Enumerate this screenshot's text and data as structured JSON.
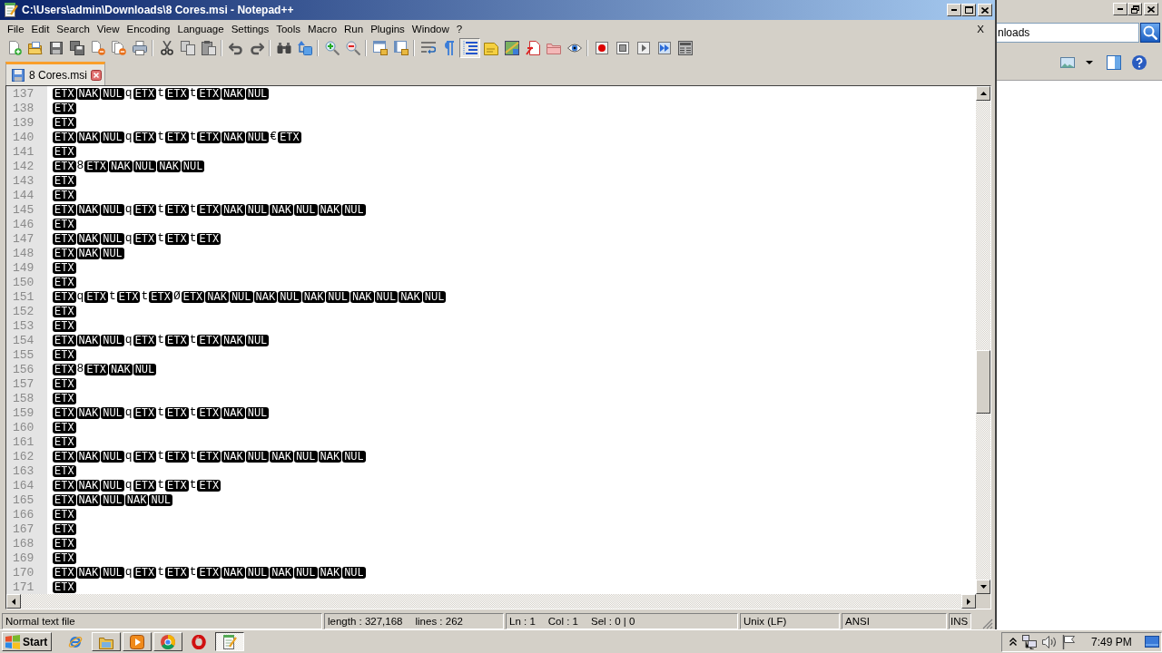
{
  "window": {
    "title": "C:\\Users\\admin\\Downloads\\8 Cores.msi - Notepad++"
  },
  "menu": {
    "items": [
      "File",
      "Edit",
      "Search",
      "View",
      "Encoding",
      "Language",
      "Settings",
      "Tools",
      "Macro",
      "Run",
      "Plugins",
      "Window",
      "?"
    ],
    "close": "X"
  },
  "toolbar": {
    "groups": [
      [
        {
          "kind": "new",
          "pressed": false
        },
        {
          "kind": "open",
          "pressed": false
        },
        {
          "kind": "save",
          "pressed": false
        },
        {
          "kind": "saveall",
          "pressed": false
        },
        {
          "kind": "close",
          "pressed": false
        },
        {
          "kind": "closeall",
          "pressed": false
        },
        {
          "kind": "print",
          "pressed": false
        }
      ],
      [
        {
          "kind": "cut",
          "pressed": false
        },
        {
          "kind": "copy",
          "pressed": false
        },
        {
          "kind": "paste",
          "pressed": false
        }
      ],
      [
        {
          "kind": "undo",
          "pressed": false
        },
        {
          "kind": "redo",
          "pressed": false
        }
      ],
      [
        {
          "kind": "find",
          "pressed": false
        },
        {
          "kind": "replace",
          "pressed": false
        }
      ],
      [
        {
          "kind": "zoomin",
          "pressed": false
        },
        {
          "kind": "zoomout",
          "pressed": false
        }
      ],
      [
        {
          "kind": "syncv",
          "pressed": false
        },
        {
          "kind": "synch",
          "pressed": false
        }
      ],
      [
        {
          "kind": "wrap",
          "pressed": false
        },
        {
          "kind": "allchars",
          "pressed": false
        },
        {
          "kind": "indent",
          "pressed": true
        },
        {
          "kind": "udl",
          "pressed": false
        },
        {
          "kind": "docmap",
          "pressed": false
        },
        {
          "kind": "funclist",
          "pressed": false
        },
        {
          "kind": "folder",
          "pressed": false
        },
        {
          "kind": "monitor",
          "pressed": false
        }
      ],
      [
        {
          "kind": "record",
          "pressed": false
        },
        {
          "kind": "stop",
          "pressed": false
        },
        {
          "kind": "play",
          "pressed": false
        },
        {
          "kind": "playmulti",
          "pressed": false
        },
        {
          "kind": "savemacro",
          "pressed": false
        }
      ]
    ]
  },
  "tabs": [
    {
      "label": "8 Cores.msi",
      "selected": true
    }
  ],
  "editor": {
    "lines": [
      {
        "number": "137",
        "tokens": [
          {
            "kind": "ctrl",
            "text": "ETX"
          },
          {
            "kind": "ctrl",
            "text": "NAK"
          },
          {
            "kind": "ctrl",
            "text": "NUL"
          },
          {
            "kind": "char",
            "text": "q"
          },
          {
            "kind": "ctrl",
            "text": "ETX"
          },
          {
            "kind": "char",
            "text": "t"
          },
          {
            "kind": "ctrl",
            "text": "ETX"
          },
          {
            "kind": "char",
            "text": "t"
          },
          {
            "kind": "ctrl",
            "text": "ETX"
          },
          {
            "kind": "ctrl",
            "text": "NAK"
          },
          {
            "kind": "ctrl",
            "text": "NUL"
          }
        ]
      },
      {
        "number": "138",
        "tokens": [
          {
            "kind": "ctrl",
            "text": "ETX"
          }
        ]
      },
      {
        "number": "139",
        "tokens": [
          {
            "kind": "ctrl",
            "text": "ETX"
          }
        ]
      },
      {
        "number": "140",
        "tokens": [
          {
            "kind": "ctrl",
            "text": "ETX"
          },
          {
            "kind": "ctrl",
            "text": "NAK"
          },
          {
            "kind": "ctrl",
            "text": "NUL"
          },
          {
            "kind": "char",
            "text": "q"
          },
          {
            "kind": "ctrl",
            "text": "ETX"
          },
          {
            "kind": "char",
            "text": "t"
          },
          {
            "kind": "ctrl",
            "text": "ETX"
          },
          {
            "kind": "char",
            "text": "t"
          },
          {
            "kind": "ctrl",
            "text": "ETX"
          },
          {
            "kind": "ctrl",
            "text": "NAK"
          },
          {
            "kind": "ctrl",
            "text": "NUL"
          },
          {
            "kind": "char",
            "text": "€"
          },
          {
            "kind": "ctrl",
            "text": "ETX"
          }
        ]
      },
      {
        "number": "141",
        "tokens": [
          {
            "kind": "ctrl",
            "text": "ETX"
          }
        ]
      },
      {
        "number": "142",
        "tokens": [
          {
            "kind": "ctrl",
            "text": "ETX"
          },
          {
            "kind": "char",
            "text": "8"
          },
          {
            "kind": "ctrl",
            "text": "ETX"
          },
          {
            "kind": "ctrl",
            "text": "NAK"
          },
          {
            "kind": "ctrl",
            "text": "NUL"
          },
          {
            "kind": "ctrl",
            "text": "NAK"
          },
          {
            "kind": "ctrl",
            "text": "NUL"
          }
        ]
      },
      {
        "number": "143",
        "tokens": [
          {
            "kind": "ctrl",
            "text": "ETX"
          }
        ]
      },
      {
        "number": "144",
        "tokens": [
          {
            "kind": "ctrl",
            "text": "ETX"
          }
        ]
      },
      {
        "number": "145",
        "tokens": [
          {
            "kind": "ctrl",
            "text": "ETX"
          },
          {
            "kind": "ctrl",
            "text": "NAK"
          },
          {
            "kind": "ctrl",
            "text": "NUL"
          },
          {
            "kind": "char",
            "text": "q"
          },
          {
            "kind": "ctrl",
            "text": "ETX"
          },
          {
            "kind": "char",
            "text": "t"
          },
          {
            "kind": "ctrl",
            "text": "ETX"
          },
          {
            "kind": "char",
            "text": "t"
          },
          {
            "kind": "ctrl",
            "text": "ETX"
          },
          {
            "kind": "ctrl",
            "text": "NAK"
          },
          {
            "kind": "ctrl",
            "text": "NUL"
          },
          {
            "kind": "ctrl",
            "text": "NAK"
          },
          {
            "kind": "ctrl",
            "text": "NUL"
          },
          {
            "kind": "ctrl",
            "text": "NAK"
          },
          {
            "kind": "ctrl",
            "text": "NUL"
          }
        ]
      },
      {
        "number": "146",
        "tokens": [
          {
            "kind": "ctrl",
            "text": "ETX"
          }
        ]
      },
      {
        "number": "147",
        "tokens": [
          {
            "kind": "ctrl",
            "text": "ETX"
          },
          {
            "kind": "ctrl",
            "text": "NAK"
          },
          {
            "kind": "ctrl",
            "text": "NUL"
          },
          {
            "kind": "char",
            "text": "q"
          },
          {
            "kind": "ctrl",
            "text": "ETX"
          },
          {
            "kind": "char",
            "text": "t"
          },
          {
            "kind": "ctrl",
            "text": "ETX"
          },
          {
            "kind": "char",
            "text": "t"
          },
          {
            "kind": "ctrl",
            "text": "ETX"
          }
        ]
      },
      {
        "number": "148",
        "tokens": [
          {
            "kind": "ctrl",
            "text": "ETX"
          },
          {
            "kind": "ctrl",
            "text": "NAK"
          },
          {
            "kind": "ctrl",
            "text": "NUL"
          }
        ]
      },
      {
        "number": "149",
        "tokens": [
          {
            "kind": "ctrl",
            "text": "ETX"
          }
        ]
      },
      {
        "number": "150",
        "tokens": [
          {
            "kind": "ctrl",
            "text": "ETX"
          }
        ]
      },
      {
        "number": "151",
        "tokens": [
          {
            "kind": "ctrl",
            "text": "ETX"
          },
          {
            "kind": "char",
            "text": "q"
          },
          {
            "kind": "ctrl",
            "text": "ETX"
          },
          {
            "kind": "char",
            "text": "t"
          },
          {
            "kind": "ctrl",
            "text": "ETX"
          },
          {
            "kind": "char",
            "text": "t"
          },
          {
            "kind": "ctrl",
            "text": "ETX"
          },
          {
            "kind": "char",
            "text": "Ø"
          },
          {
            "kind": "ctrl",
            "text": "ETX"
          },
          {
            "kind": "ctrl",
            "text": "NAK"
          },
          {
            "kind": "ctrl",
            "text": "NUL"
          },
          {
            "kind": "ctrl",
            "text": "NAK"
          },
          {
            "kind": "ctrl",
            "text": "NUL"
          },
          {
            "kind": "ctrl",
            "text": "NAK"
          },
          {
            "kind": "ctrl",
            "text": "NUL"
          },
          {
            "kind": "ctrl",
            "text": "NAK"
          },
          {
            "kind": "ctrl",
            "text": "NUL"
          },
          {
            "kind": "ctrl",
            "text": "NAK"
          },
          {
            "kind": "ctrl",
            "text": "NUL"
          }
        ]
      },
      {
        "number": "152",
        "tokens": [
          {
            "kind": "ctrl",
            "text": "ETX"
          }
        ]
      },
      {
        "number": "153",
        "tokens": [
          {
            "kind": "ctrl",
            "text": "ETX"
          }
        ]
      },
      {
        "number": "154",
        "tokens": [
          {
            "kind": "ctrl",
            "text": "ETX"
          },
          {
            "kind": "ctrl",
            "text": "NAK"
          },
          {
            "kind": "ctrl",
            "text": "NUL"
          },
          {
            "kind": "char",
            "text": "q"
          },
          {
            "kind": "ctrl",
            "text": "ETX"
          },
          {
            "kind": "char",
            "text": "t"
          },
          {
            "kind": "ctrl",
            "text": "ETX"
          },
          {
            "kind": "char",
            "text": "t"
          },
          {
            "kind": "ctrl",
            "text": "ETX"
          },
          {
            "kind": "ctrl",
            "text": "NAK"
          },
          {
            "kind": "ctrl",
            "text": "NUL"
          }
        ]
      },
      {
        "number": "155",
        "tokens": [
          {
            "kind": "ctrl",
            "text": "ETX"
          }
        ]
      },
      {
        "number": "156",
        "tokens": [
          {
            "kind": "ctrl",
            "text": "ETX"
          },
          {
            "kind": "char",
            "text": "8"
          },
          {
            "kind": "ctrl",
            "text": "ETX"
          },
          {
            "kind": "ctrl",
            "text": "NAK"
          },
          {
            "kind": "ctrl",
            "text": "NUL"
          }
        ]
      },
      {
        "number": "157",
        "tokens": [
          {
            "kind": "ctrl",
            "text": "ETX"
          }
        ]
      },
      {
        "number": "158",
        "tokens": [
          {
            "kind": "ctrl",
            "text": "ETX"
          }
        ]
      },
      {
        "number": "159",
        "tokens": [
          {
            "kind": "ctrl",
            "text": "ETX"
          },
          {
            "kind": "ctrl",
            "text": "NAK"
          },
          {
            "kind": "ctrl",
            "text": "NUL"
          },
          {
            "kind": "char",
            "text": "q"
          },
          {
            "kind": "ctrl",
            "text": "ETX"
          },
          {
            "kind": "char",
            "text": "t"
          },
          {
            "kind": "ctrl",
            "text": "ETX"
          },
          {
            "kind": "char",
            "text": "t"
          },
          {
            "kind": "ctrl",
            "text": "ETX"
          },
          {
            "kind": "ctrl",
            "text": "NAK"
          },
          {
            "kind": "ctrl",
            "text": "NUL"
          }
        ]
      },
      {
        "number": "160",
        "tokens": [
          {
            "kind": "ctrl",
            "text": "ETX"
          }
        ]
      },
      {
        "number": "161",
        "tokens": [
          {
            "kind": "ctrl",
            "text": "ETX"
          }
        ]
      },
      {
        "number": "162",
        "tokens": [
          {
            "kind": "ctrl",
            "text": "ETX"
          },
          {
            "kind": "ctrl",
            "text": "NAK"
          },
          {
            "kind": "ctrl",
            "text": "NUL"
          },
          {
            "kind": "char",
            "text": "q"
          },
          {
            "kind": "ctrl",
            "text": "ETX"
          },
          {
            "kind": "char",
            "text": "t"
          },
          {
            "kind": "ctrl",
            "text": "ETX"
          },
          {
            "kind": "char",
            "text": "t"
          },
          {
            "kind": "ctrl",
            "text": "ETX"
          },
          {
            "kind": "ctrl",
            "text": "NAK"
          },
          {
            "kind": "ctrl",
            "text": "NUL"
          },
          {
            "kind": "ctrl",
            "text": "NAK"
          },
          {
            "kind": "ctrl",
            "text": "NUL"
          },
          {
            "kind": "ctrl",
            "text": "NAK"
          },
          {
            "kind": "ctrl",
            "text": "NUL"
          }
        ]
      },
      {
        "number": "163",
        "tokens": [
          {
            "kind": "ctrl",
            "text": "ETX"
          }
        ]
      },
      {
        "number": "164",
        "tokens": [
          {
            "kind": "ctrl",
            "text": "ETX"
          },
          {
            "kind": "ctrl",
            "text": "NAK"
          },
          {
            "kind": "ctrl",
            "text": "NUL"
          },
          {
            "kind": "char",
            "text": "q"
          },
          {
            "kind": "ctrl",
            "text": "ETX"
          },
          {
            "kind": "char",
            "text": "t"
          },
          {
            "kind": "ctrl",
            "text": "ETX"
          },
          {
            "kind": "char",
            "text": "t"
          },
          {
            "kind": "ctrl",
            "text": "ETX"
          }
        ]
      },
      {
        "number": "165",
        "tokens": [
          {
            "kind": "ctrl",
            "text": "ETX"
          },
          {
            "kind": "ctrl",
            "text": "NAK"
          },
          {
            "kind": "ctrl",
            "text": "NUL"
          },
          {
            "kind": "ctrl",
            "text": "NAK"
          },
          {
            "kind": "ctrl",
            "text": "NUL"
          }
        ]
      },
      {
        "number": "166",
        "tokens": [
          {
            "kind": "ctrl",
            "text": "ETX"
          }
        ]
      },
      {
        "number": "167",
        "tokens": [
          {
            "kind": "ctrl",
            "text": "ETX"
          }
        ]
      },
      {
        "number": "168",
        "tokens": [
          {
            "kind": "ctrl",
            "text": "ETX"
          }
        ]
      },
      {
        "number": "169",
        "tokens": [
          {
            "kind": "ctrl",
            "text": "ETX"
          }
        ]
      },
      {
        "number": "170",
        "tokens": [
          {
            "kind": "ctrl",
            "text": "ETX"
          },
          {
            "kind": "ctrl",
            "text": "NAK"
          },
          {
            "kind": "ctrl",
            "text": "NUL"
          },
          {
            "kind": "char",
            "text": "q"
          },
          {
            "kind": "ctrl",
            "text": "ETX"
          },
          {
            "kind": "char",
            "text": "t"
          },
          {
            "kind": "ctrl",
            "text": "ETX"
          },
          {
            "kind": "char",
            "text": "t"
          },
          {
            "kind": "ctrl",
            "text": "ETX"
          },
          {
            "kind": "ctrl",
            "text": "NAK"
          },
          {
            "kind": "ctrl",
            "text": "NUL"
          },
          {
            "kind": "ctrl",
            "text": "NAK"
          },
          {
            "kind": "ctrl",
            "text": "NUL"
          },
          {
            "kind": "ctrl",
            "text": "NAK"
          },
          {
            "kind": "ctrl",
            "text": "NUL"
          }
        ]
      },
      {
        "number": "171",
        "tokens": [
          {
            "kind": "ctrl",
            "text": "ETX"
          }
        ]
      }
    ]
  },
  "status_bar": [
    {
      "texts": [
        "Normal text file"
      ]
    },
    {
      "texts": [
        "length : 327,168",
        "lines : 262"
      ]
    },
    {
      "texts": [
        "Ln : 1",
        "Col : 1",
        "Sel : 0 | 0"
      ]
    },
    {
      "texts": [
        "Unix (LF)"
      ]
    },
    {
      "texts": [
        "ANSI"
      ]
    },
    {
      "texts": [
        "INS"
      ]
    }
  ],
  "side_window": {
    "search": {
      "value": "nloads"
    },
    "toolbar": [
      {
        "kind": "picture"
      },
      {
        "kind": "caret"
      },
      {
        "kind": "pane"
      },
      {
        "kind": "help"
      }
    ]
  },
  "taskbar": {
    "start": "Start",
    "apps": [
      {
        "kind": "globe",
        "running": false,
        "selected": false
      },
      {
        "kind": "folder",
        "running": true,
        "selected": false
      },
      {
        "kind": "media",
        "running": true,
        "selected": false
      },
      {
        "kind": "wheel",
        "running": true,
        "selected": false
      },
      {
        "kind": "ring",
        "running": false,
        "selected": false
      },
      {
        "kind": "notepad",
        "running": true,
        "selected": true
      }
    ],
    "tray": [
      {
        "kind": "chevron"
      },
      {
        "kind": "network"
      },
      {
        "kind": "speaker"
      },
      {
        "kind": "flag"
      }
    ],
    "clock": "7:49 PM"
  }
}
